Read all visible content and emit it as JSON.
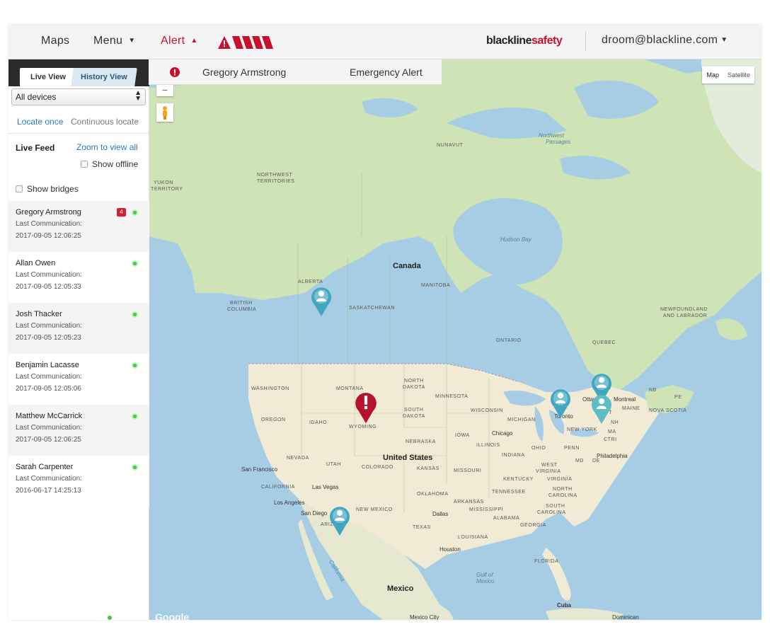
{
  "topbar": {
    "maps_label": "Maps",
    "menu_label": "Menu",
    "alert_label": "Alert",
    "brand_primary": "blackline",
    "brand_accent": "safety",
    "user_email": "droom@blackline.com"
  },
  "alert_dropdown": {
    "name": "Gregory Armstrong",
    "type": "Emergency Alert"
  },
  "sidebar": {
    "tabs": {
      "live": "Live View",
      "history": "History View"
    },
    "device_select": "All devices",
    "locate_once": "Locate once",
    "continuous_locate": "Continuous locate",
    "live_feed_title": "Live Feed",
    "zoom_view_all": "Zoom to view all",
    "show_offline": "Show offline",
    "show_bridges": "Show bridges",
    "feed": [
      {
        "name": "Gregory Armstrong",
        "label": "Last Communication:",
        "time": "2017-09-05 12:06:25",
        "alert_badge": "4"
      },
      {
        "name": "Allan Owen",
        "label": "Last Communication:",
        "time": "2017-09-05 12:05:33"
      },
      {
        "name": "Josh Thacker",
        "label": "Last Communication:",
        "time": "2017-09-05 12:05:23"
      },
      {
        "name": "Benjamin Lacasse",
        "label": "Last Communication:",
        "time": "2017-09-05 12:05:06"
      },
      {
        "name": "Matthew McCarrick",
        "label": "Last Communication:",
        "time": "2017-09-05 12:06:25"
      },
      {
        "name": "Sarah Carpenter",
        "label": "Last Communication:",
        "time": "2016-06-17 14:25:13"
      }
    ]
  },
  "map": {
    "type_map": "Map",
    "type_satellite": "Satellite",
    "google": "Google",
    "labels": {
      "nunavut": "NUNAVUT",
      "northwest_territories_1": "NORTHWEST",
      "northwest_territories_2": "TERRITORIES",
      "yukon_1": "YUKON",
      "yukon_2": "TERRITORY",
      "alberta": "ALBERTA",
      "british_columbia_1": "BRITISH",
      "british_columbia_2": "COLUMBIA",
      "saskatchewan": "SASKATCHEWAN",
      "manitoba": "MANITOBA",
      "ontario": "ONTARIO",
      "quebec": "QUEBEC",
      "newfoundland_1": "NEWFOUNDLAND",
      "newfoundland_2": "AND LABRADOR",
      "canada": "Canada",
      "united_states": "United States",
      "mexico": "Mexico",
      "cuba": "Cuba",
      "hudson_bay": "Hudson Bay",
      "northwest_passages_1": "Northwest",
      "northwest_passages_2": "Passages",
      "gulf_california_1": "Gulf of",
      "gulf_california_2": "California",
      "gulf_mexico_1": "Gulf of",
      "gulf_mexico_2": "Mexico",
      "washington": "WASHINGTON",
      "oregon": "OREGON",
      "montana": "MONTANA",
      "idaho": "IDAHO",
      "wyoming": "WYOMING",
      "north_dakota_1": "NORTH",
      "north_dakota_2": "DAKOTA",
      "south_dakota_1": "SOUTH",
      "south_dakota_2": "DAKOTA",
      "minnesota": "MINNESOTA",
      "wisconsin": "WISCONSIN",
      "michigan": "MICHIGAN",
      "nevada": "NEVADA",
      "utah": "UTAH",
      "colorado": "COLORADO",
      "nebraska": "NEBRASKA",
      "kansas": "KANSAS",
      "iowa": "IOWA",
      "illinois": "ILLINOIS",
      "indiana": "INDIANA",
      "ohio": "OHIO",
      "missouri": "MISSOURI",
      "california": "CALIFORNIA",
      "arizona": "ARIZONA",
      "new_mexico": "NEW MEXICO",
      "oklahoma": "OKLAHOMA",
      "arkansas": "ARKANSAS",
      "texas": "TEXAS",
      "louisiana": "LOUISIANA",
      "mississippi": "MISSISSIPPI",
      "alabama": "ALABAMA",
      "georgia": "GEORGIA",
      "tennessee": "TENNESSEE",
      "kentucky": "KENTUCKY",
      "west_virginia_1": "WEST",
      "west_virginia_2": "VIRGINIA",
      "virginia": "VIRGINIA",
      "north_carolina_1": "NORTH",
      "north_carolina_2": "CAROLINA",
      "south_carolina_1": "SOUTH",
      "south_carolina_2": "CAROLINA",
      "florida": "FLORIDA",
      "penn": "PENN",
      "new_york": "NEW YORK",
      "maine": "MAINE",
      "nova_scotia": "NOVA SCOTIA",
      "nb": "NB",
      "pe": "PE",
      "nh": "NH",
      "ma": "MA",
      "ctri": "CTRI",
      "md": "MD",
      "de": "DE",
      "vt": "VT"
    },
    "cities": {
      "san_francisco": "San Francisco",
      "los_angeles": "Los Angeles",
      "san_diego": "San Diego",
      "las_vegas": "Las Vegas",
      "chicago": "Chicago",
      "toronto": "Toronto",
      "ottawa": "Ottawa",
      "montreal": "Montreal",
      "philadelphia": "Philadelphia",
      "dallas": "Dallas",
      "houston": "Houston",
      "mexico_city": "Mexico City",
      "dominican": "Dominican"
    }
  },
  "colors": {
    "alert_red": "#c8102e",
    "link_blue": "#2a7bbf",
    "marker_teal": "#3fa7bf",
    "online_green": "#4cc14a",
    "land": "#cfe4b6",
    "us_land": "#f1ead5",
    "water": "#a6cde4"
  },
  "icons": [
    "caret-down-icon",
    "caret-up-icon",
    "alert-logo-icon",
    "alert-exclamation-icon",
    "select-arrows-icon",
    "checkbox-icon",
    "status-online-icon",
    "alert-badge-icon",
    "pegman-icon",
    "person-marker-icon",
    "emergency-marker-icon"
  ]
}
